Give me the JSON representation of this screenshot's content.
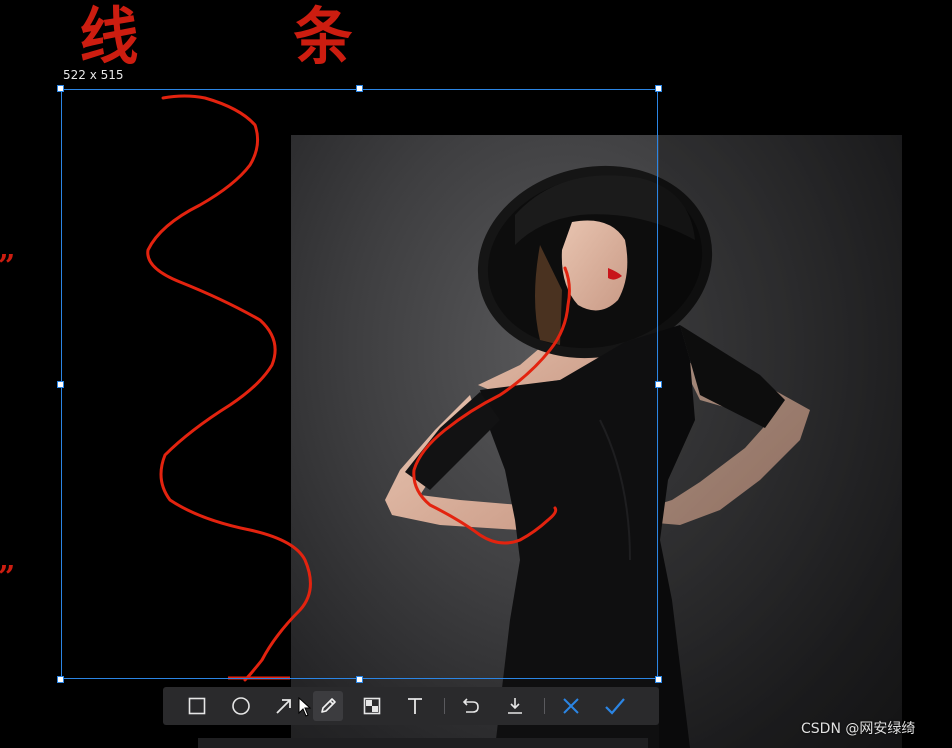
{
  "slide": {
    "heading_left": "线",
    "heading_right": "条",
    "quote_top": "”",
    "quote_bottom": "”"
  },
  "screenshot_tool": {
    "size_label": "522 x 515",
    "selection_color": "#2b85e4",
    "pen_color": "#e3230f",
    "toolbar": {
      "tools": [
        {
          "name": "rectangle",
          "icon": "square-icon"
        },
        {
          "name": "ellipse",
          "icon": "circle-icon"
        },
        {
          "name": "arrow",
          "icon": "arrow-icon"
        },
        {
          "name": "pencil",
          "icon": "pencil-icon",
          "active": true
        },
        {
          "name": "mosaic",
          "icon": "mosaic-icon"
        },
        {
          "name": "text",
          "icon": "text-icon"
        },
        {
          "name": "undo",
          "icon": "undo-icon"
        },
        {
          "name": "save",
          "icon": "download-icon"
        },
        {
          "name": "cancel",
          "icon": "close-icon",
          "color": "#2b85e4"
        },
        {
          "name": "confirm",
          "icon": "check-icon",
          "color": "#2b85e4"
        }
      ]
    }
  },
  "watermark": "CSDN @网安绿绮"
}
